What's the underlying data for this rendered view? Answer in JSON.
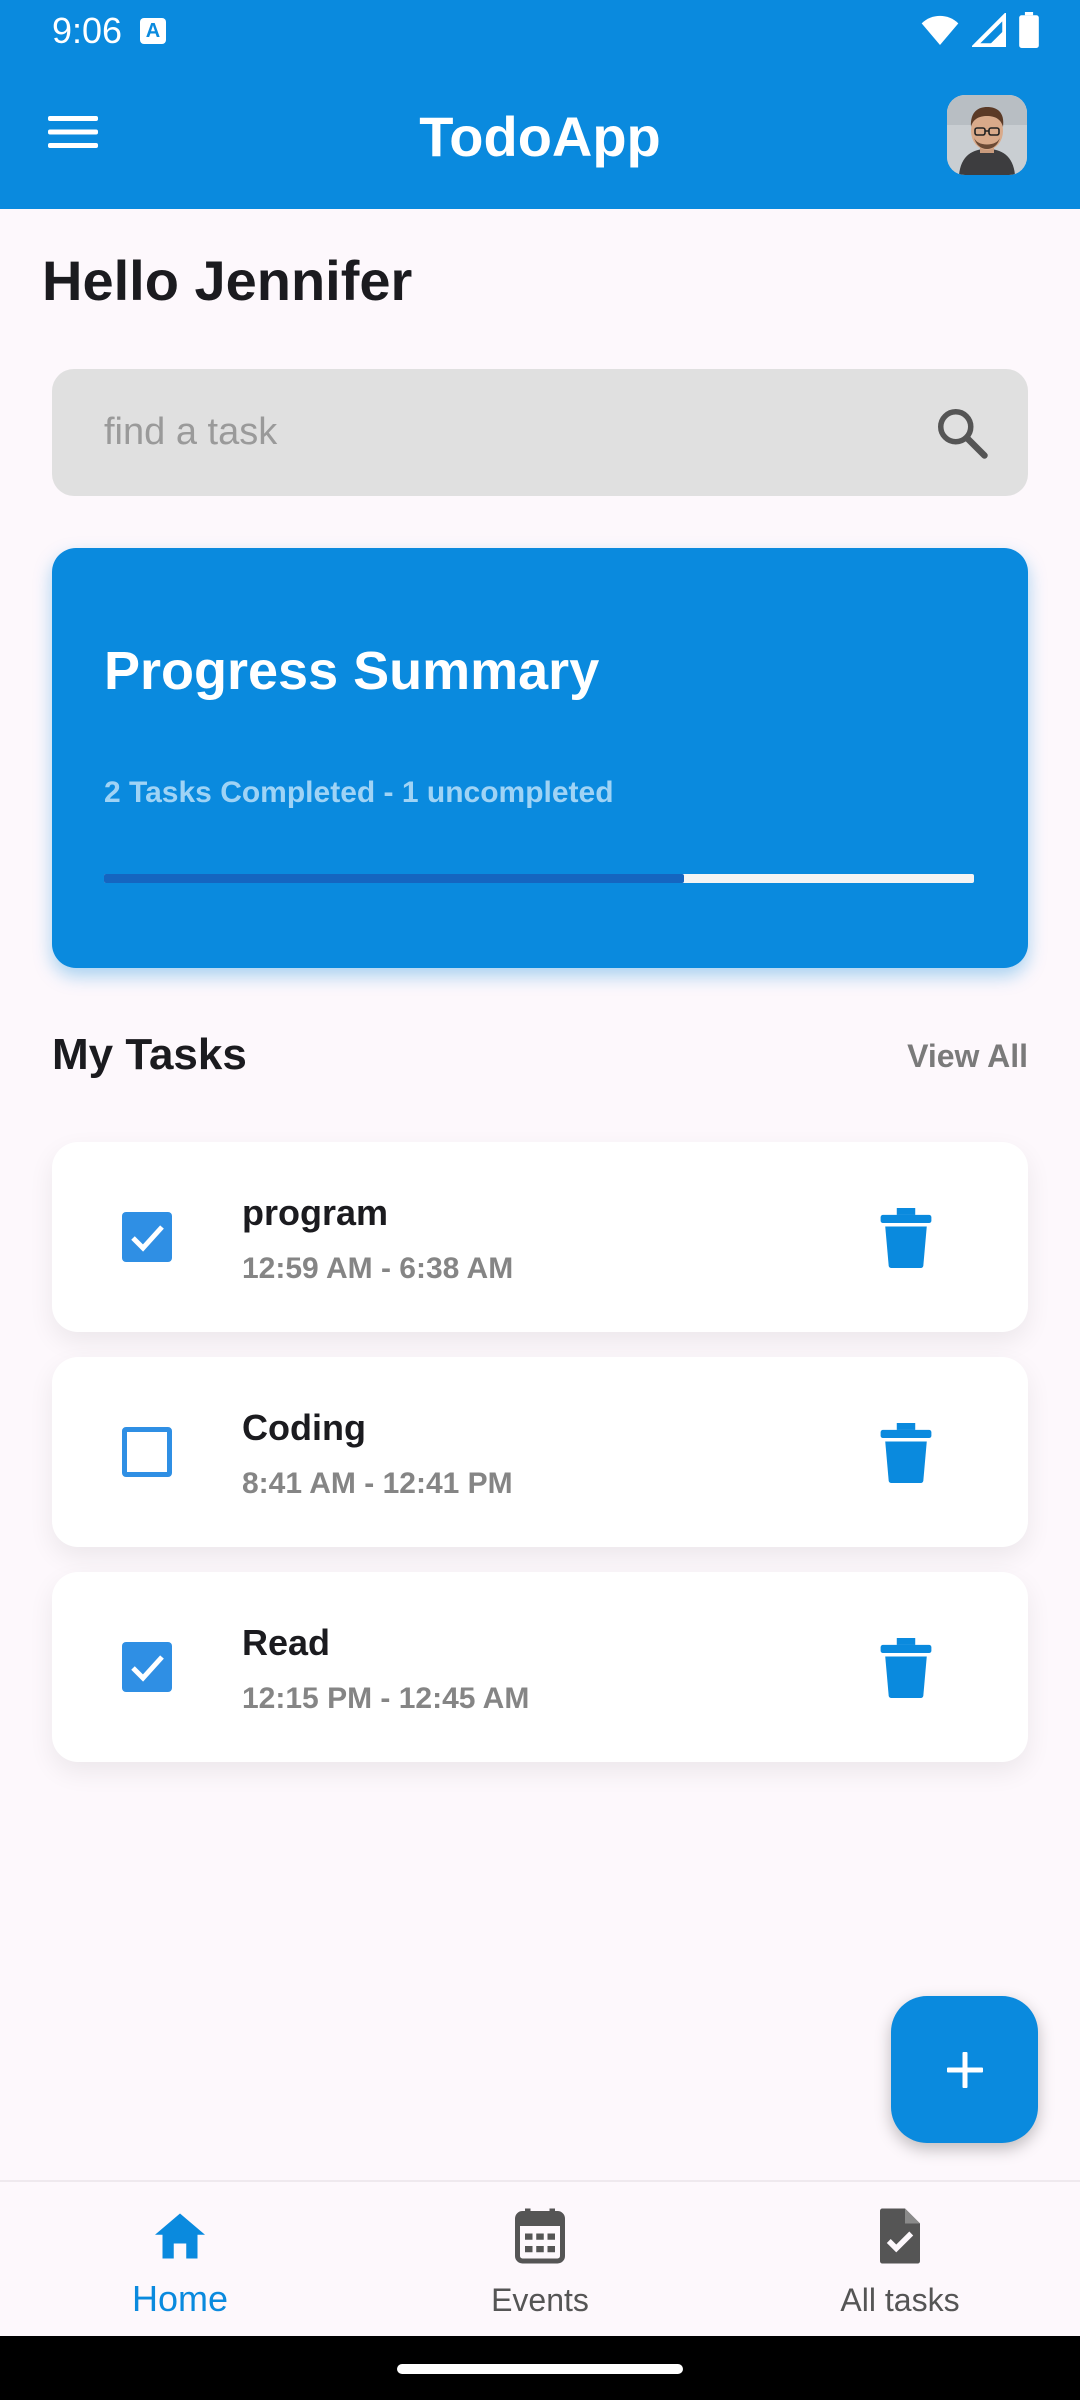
{
  "status_bar": {
    "time": "9:06",
    "notification_letter": "A"
  },
  "app_bar": {
    "title": "TodoApp"
  },
  "greeting": "Hello Jennifer",
  "search": {
    "placeholder": "find a task",
    "value": ""
  },
  "progress": {
    "title": "Progress Summary",
    "subtitle": "2 Tasks Completed - 1 uncompleted",
    "fraction": 0.667
  },
  "tasks_section": {
    "title": "My Tasks",
    "view_all_label": "View All"
  },
  "tasks": [
    {
      "name": "program",
      "time": "12:59 AM - 6:38 AM",
      "completed": true
    },
    {
      "name": "Coding",
      "time": "8:41 AM - 12:41 PM",
      "completed": false
    },
    {
      "name": "Read",
      "time": "12:15 PM - 12:45 AM",
      "completed": true
    }
  ],
  "bottom_nav": [
    {
      "label": "Home",
      "icon": "home-icon",
      "active": true
    },
    {
      "label": "Events",
      "icon": "calendar-icon",
      "active": false
    },
    {
      "label": "All tasks",
      "icon": "task-document-icon",
      "active": false
    }
  ],
  "colors": {
    "primary": "#0a8ade",
    "progress_fill": "#1565c0",
    "checkbox": "#2f8fe4",
    "background": "#fdf8fc"
  }
}
